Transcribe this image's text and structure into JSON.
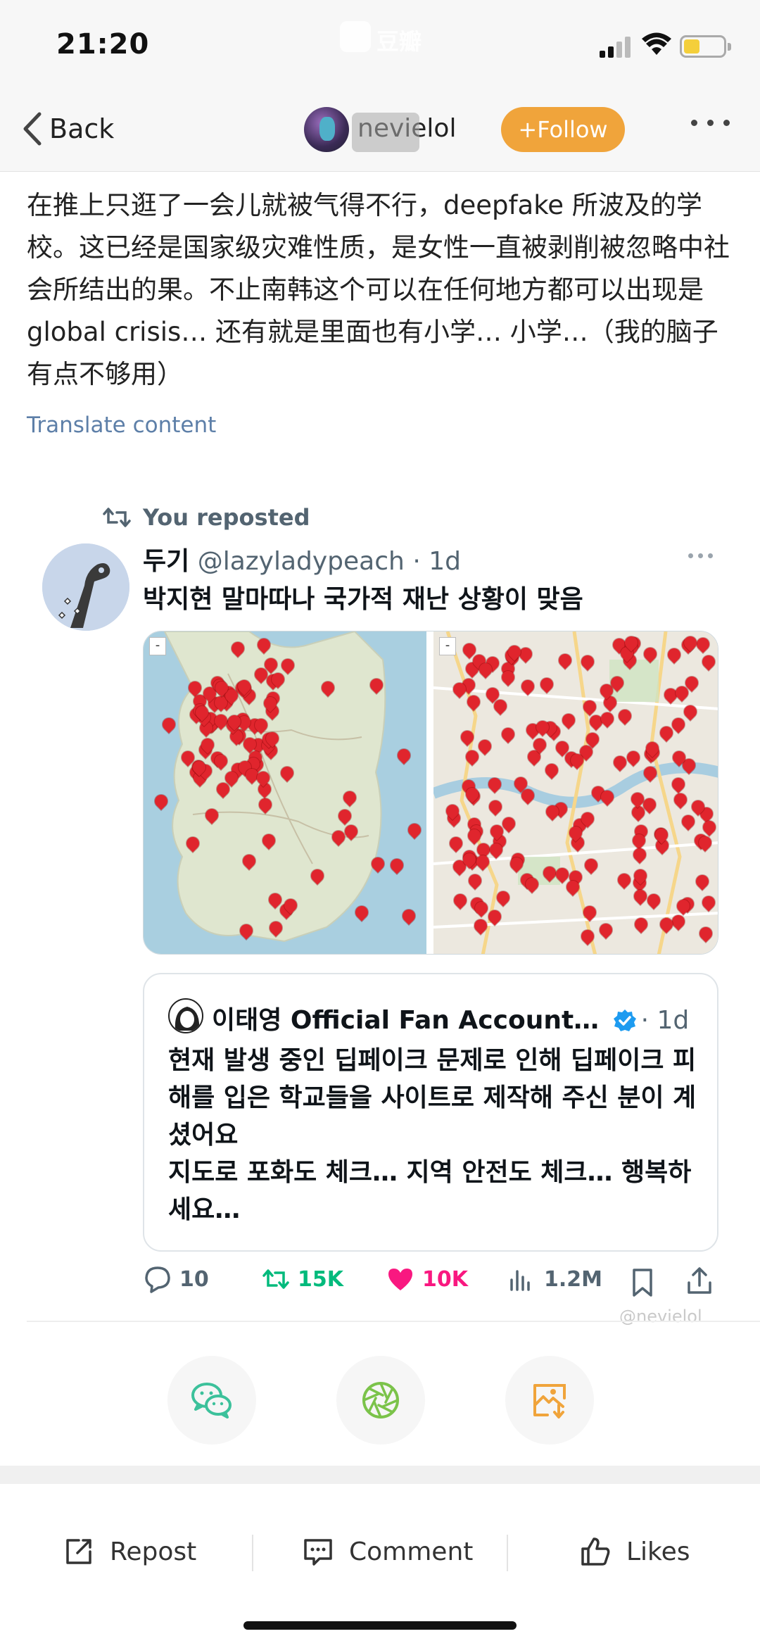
{
  "status_bar": {
    "time": "21:20",
    "center_app_text": "豆瓣"
  },
  "nav": {
    "back_label": "Back",
    "username": "nevielol",
    "follow_label": "+Follow"
  },
  "post": {
    "text": "在推上只逛了一会儿就被气得不行，deepfake 所波及的学校。这已经是国家级灾难性质，是女性一直被剥削被忽略中社会所结出的果。不止南韩这个可以在任何地方都可以出现是 global crisis… 还有就是里面也有小学… 小学…（我的脑子有点不够用）",
    "translate_label": "Translate content"
  },
  "tweet": {
    "repost_label": "You reposted",
    "display_name": "두기",
    "handle": "@lazyladypeach",
    "time": "· 1d",
    "text": "박지현 말마따나 국가적 재난 상황이 맞음",
    "quote": {
      "display_name": "이태영 Official Fan Account…",
      "time": "· 1d",
      "text": "현재 발생 중인 딥페이크 문제로 인해 딥페이크 피해를 입은 학교들을 사이트로 제작해 주신 분이 계셨어요\n지도로 포화도 체크… 지역 안전도 체크… 행복하세요…"
    },
    "stats": {
      "replies": "10",
      "retweets": "15K",
      "likes": "10K",
      "views": "1.2M"
    },
    "watermark": "@nevielol"
  },
  "bottom_bar": {
    "repost_label": "Repost",
    "comment_label": "Comment",
    "likes_label": "Likes"
  },
  "colors": {
    "follow_orange": "#f0a43b",
    "link_blue": "#5d7fa8",
    "retweet_green": "#00ba7c",
    "like_pink": "#f91880",
    "marker_red": "#e0252d",
    "verified_blue": "#1d9bf0"
  },
  "icons": {
    "share_buttons": [
      "wechat-icon",
      "moments-icon",
      "save-image-icon"
    ]
  }
}
